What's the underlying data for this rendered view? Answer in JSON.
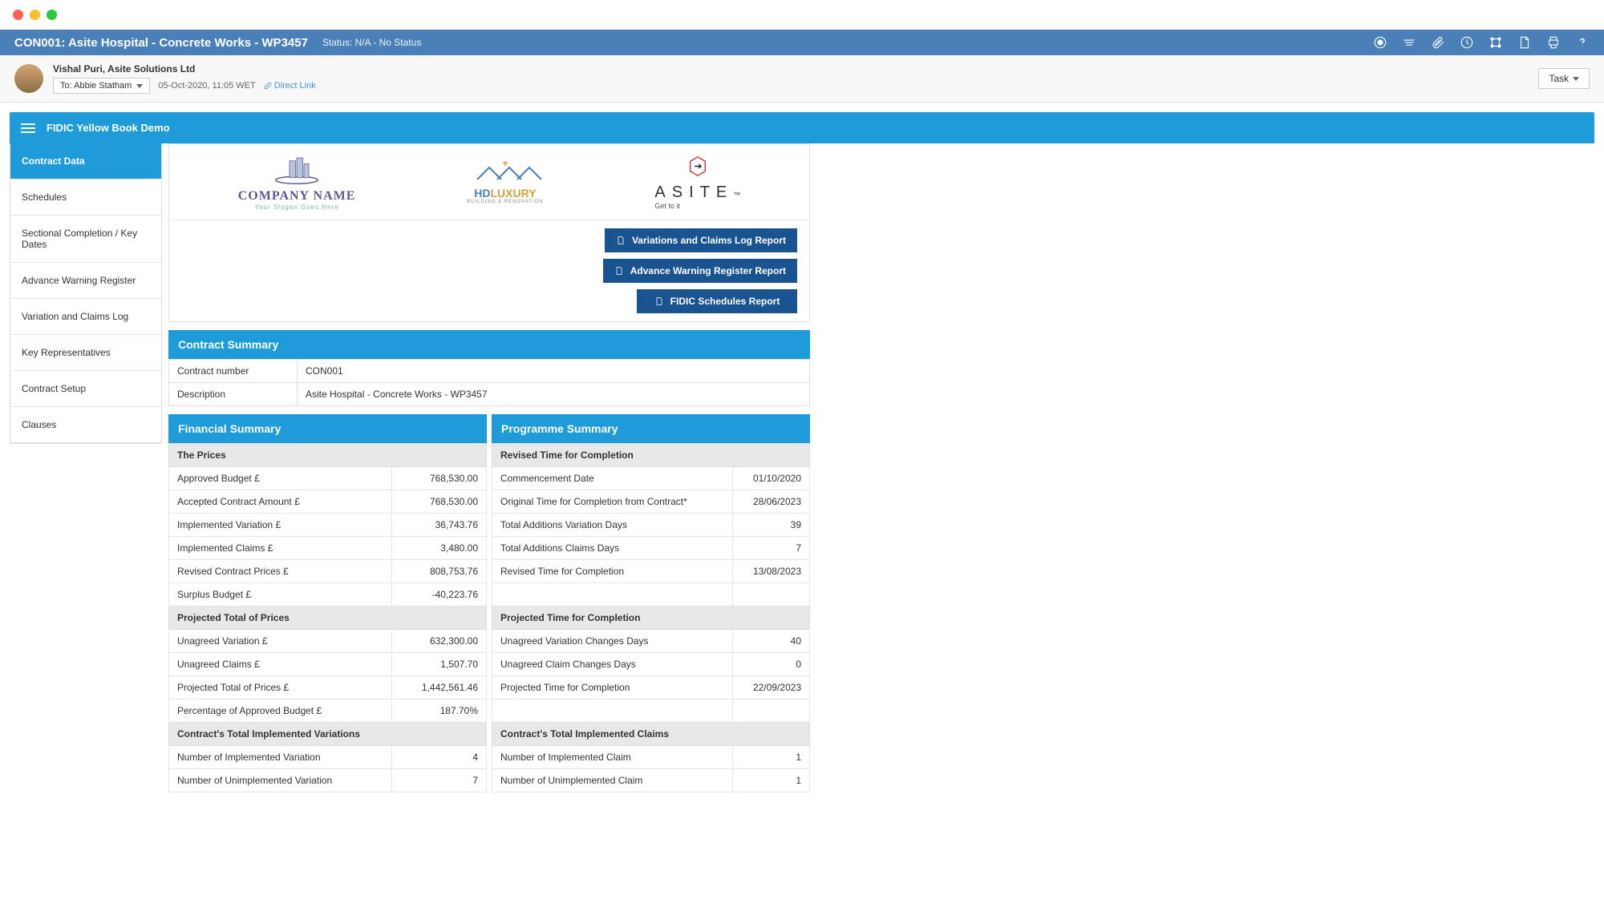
{
  "header": {
    "title": "CON001: Asite Hospital - Concrete Works - WP3457",
    "status": "Status: N/A - No Status"
  },
  "meta": {
    "user": "Vishal Puri, Asite Solutions Ltd",
    "to": "To: Abbie Statham",
    "date": "05-Oct-2020, 11:05 WET",
    "directLink": "Direct Link",
    "task": "Task"
  },
  "module": {
    "title": "FIDIC Yellow Book Demo"
  },
  "sidebar": {
    "items": [
      "Contract Data",
      "Schedules",
      "Sectional Completion / Key Dates",
      "Advance Warning Register",
      "Variation and Claims Log",
      "Key Representatives",
      "Contract Setup",
      "Clauses"
    ]
  },
  "logos": {
    "logo1": {
      "name": "COMPANY NAME",
      "slogan": "Your Slogan Goes Here"
    },
    "logo2": {
      "prefix": "HD",
      "suffix": "LUXURY",
      "sub": "BUILDING & RENOVATION"
    },
    "logo3": {
      "name": "ASITE",
      "suffix": "™",
      "slogan": "Get to it"
    }
  },
  "reports": {
    "b1": "Variations and Claims Log Report",
    "b2": "Advance Warning Register Report",
    "b3": "FIDIC Schedules Report"
  },
  "contractSummary": {
    "title": "Contract Summary",
    "numberLabel": "Contract number",
    "numberValue": "CON001",
    "descLabel": "Description",
    "descValue": "Asite Hospital - Concrete Works - WP3457"
  },
  "financial": {
    "title": "Financial Summary",
    "sections": {
      "prices": "The Prices",
      "projected": "Projected Total of Prices",
      "implemented": "Contract's Total Implemented Variations"
    },
    "rows": {
      "r1l": "Approved Budget £",
      "r1v": "768,530.00",
      "r2l": "Accepted Contract Amount £",
      "r2v": "768,530.00",
      "r3l": "Implemented Variation £",
      "r3v": "36,743.76",
      "r4l": "Implemented Claims £",
      "r4v": "3,480.00",
      "r5l": "Revised Contract Prices £",
      "r5v": "808,753.76",
      "r6l": "Surplus Budget £",
      "r6v": "-40,223.76",
      "r7l": "Unagreed Variation £",
      "r7v": "632,300.00",
      "r8l": "Unagreed Claims £",
      "r8v": "1,507.70",
      "r9l": "Projected Total of Prices £",
      "r9v": "1,442,561.46",
      "r10l": "Percentage of Approved Budget £",
      "r10v": "187.70%",
      "r11l": "Number of Implemented Variation",
      "r11v": "4",
      "r12l": "Number of Unimplemented Variation",
      "r12v": "7"
    }
  },
  "programme": {
    "title": "Programme Summary",
    "sections": {
      "revised": "Revised Time for Completion",
      "projected": "Projected Time for Completion",
      "implemented": "Contract's Total Implemented Claims"
    },
    "rows": {
      "r1l": "Commencement Date",
      "r1v": "01/10/2020",
      "r2l": "Original Time for Completion from Contract*",
      "r2v": "28/06/2023",
      "r3l": "Total Additions Variation Days",
      "r3v": "39",
      "r4l": "Total Additions Claims Days",
      "r4v": "7",
      "r5l": "Revised Time for Completion",
      "r5v": "13/08/2023",
      "r7l": "Unagreed Variation Changes Days",
      "r7v": "40",
      "r8l": "Unagreed Claim Changes Days",
      "r8v": "0",
      "r9l": "Projected Time for Completion",
      "r9v": "22/09/2023",
      "r11l": "Number of Implemented Claim",
      "r11v": "1",
      "r12l": "Number of Unimplemented Claim",
      "r12v": "1"
    }
  }
}
